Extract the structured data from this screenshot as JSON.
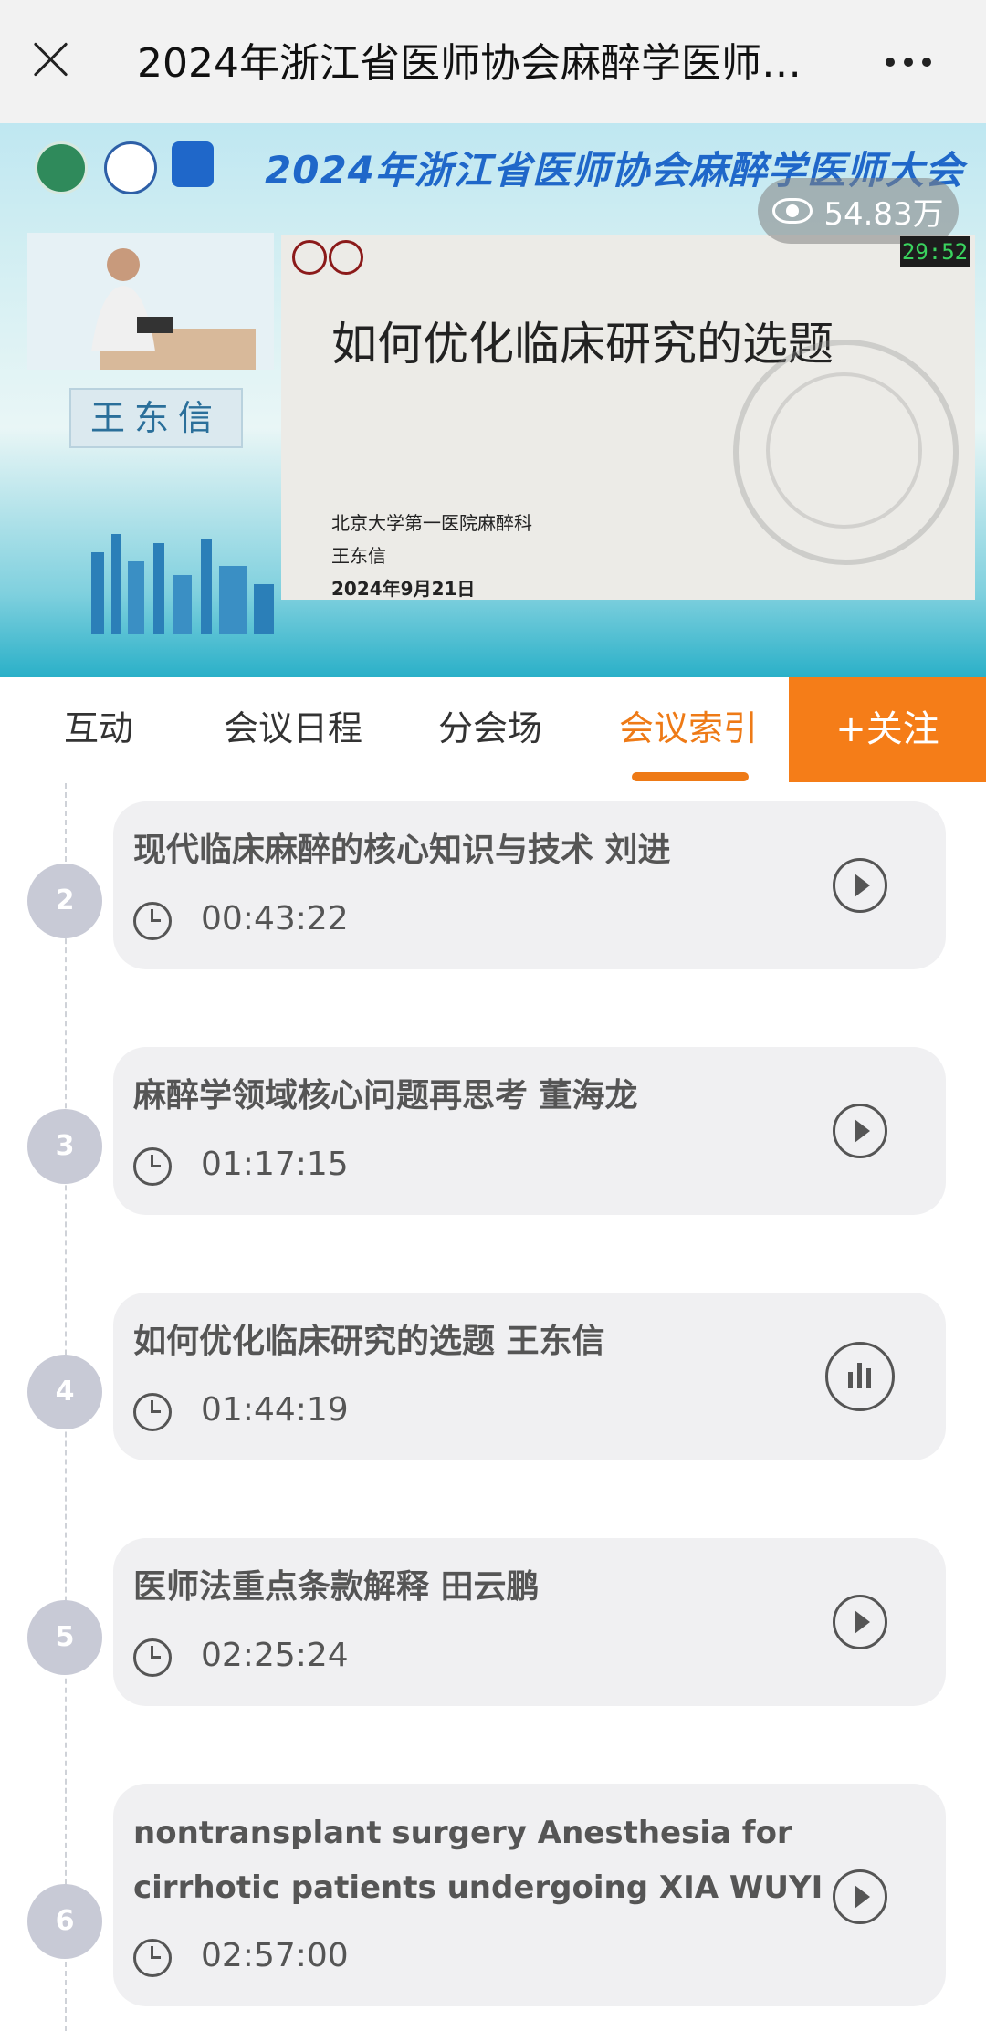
{
  "header": {
    "title": "2024年浙江省医师协会麻醉学医师大会",
    "close_icon": "close-icon",
    "more_icon": "more-icon"
  },
  "video": {
    "banner_title": "2024年浙江省医师协会麻醉学医师大会",
    "views": "54.83万",
    "timer": "29:52",
    "speaker_name": "王东信",
    "slide": {
      "title": "如何优化临床研究的选题",
      "department": "北京大学第一医院麻醉科",
      "presenter": "王东信",
      "date": "2024年9月21日"
    }
  },
  "tabs": [
    {
      "label": "互动"
    },
    {
      "label": "会议日程"
    },
    {
      "label": "分会场"
    },
    {
      "label": "会议索引",
      "active": true
    }
  ],
  "follow_label": "+关注",
  "accent_color": "#ee7a16",
  "schedule": [
    {
      "index": "2",
      "title": "现代临床麻醉的核心知识与技术 刘进",
      "duration": "00:43:22",
      "status": "play"
    },
    {
      "index": "3",
      "title": "麻醉学领域核心问题再思考 董海龙",
      "duration": "01:17:15",
      "status": "play"
    },
    {
      "index": "4",
      "title": "如何优化临床研究的选题 王东信",
      "duration": "01:44:19",
      "status": "playing"
    },
    {
      "index": "5",
      "title": "医师法重点条款解释 田云鹏",
      "duration": "02:25:24",
      "status": "play"
    },
    {
      "index": "6",
      "title": "nontransplant surgery Anesthesia for cirrhotic patients undergoing XIA WUYI",
      "duration": "02:57:00",
      "status": "play"
    }
  ]
}
